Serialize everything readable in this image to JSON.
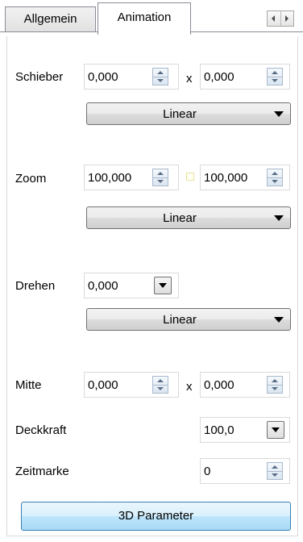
{
  "tabs": [
    {
      "label": "Allgemein",
      "active": false
    },
    {
      "label": "Animation",
      "active": true
    }
  ],
  "schieber": {
    "label": "Schieber",
    "x_value": "0,000",
    "separator": "x",
    "y_value": "0,000",
    "interpolation": "Linear"
  },
  "zoom": {
    "label": "Zoom",
    "x_value": "100,000",
    "y_value": "100,000",
    "interpolation": "Linear"
  },
  "drehen": {
    "label": "Drehen",
    "value": "0,000",
    "interpolation": "Linear"
  },
  "mitte": {
    "label": "Mitte",
    "x_value": "0,000",
    "separator": "x",
    "y_value": "0,000"
  },
  "deckkraft": {
    "label": "Deckkraft",
    "value": "100,0"
  },
  "zeitmarke": {
    "label": "Zeitmarke",
    "value": "0"
  },
  "button_3d": {
    "label": "3D Parameter"
  },
  "icons": [
    "scroll-left-icon",
    "scroll-right-icon",
    "spinner-up-icon",
    "spinner-down-icon",
    "dropdown-arrow-icon",
    "aspect-lock-icon"
  ],
  "colors": {
    "accent_button": "#a7d9f5",
    "tab_border": "#898c95",
    "spinner_border": "#a9b9cc"
  }
}
